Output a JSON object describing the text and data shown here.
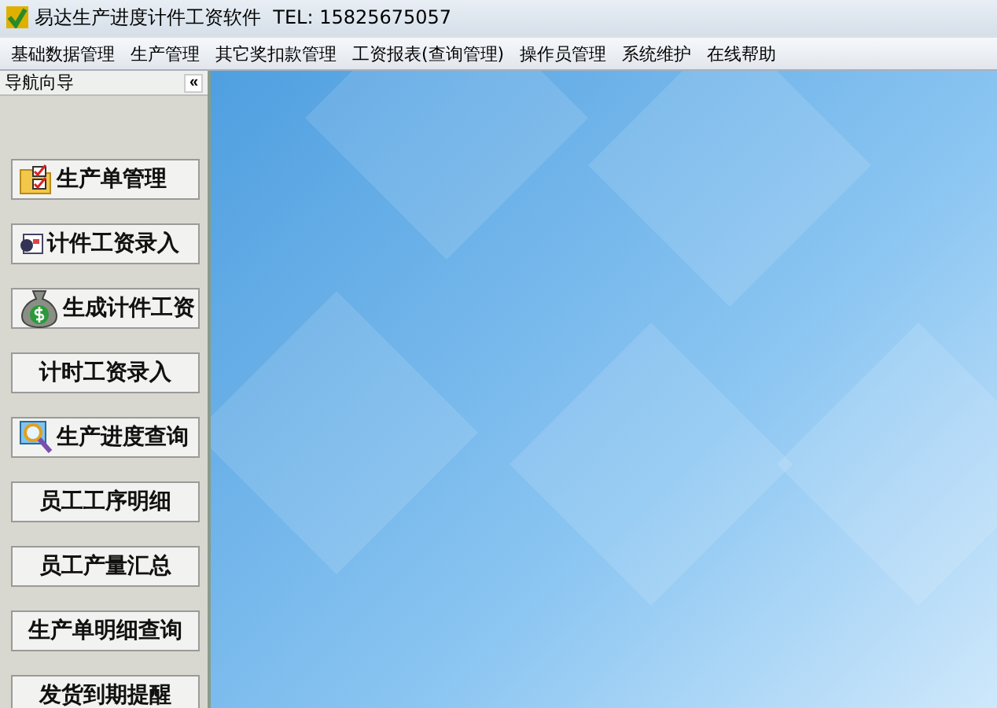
{
  "window": {
    "title": "易达生产进度计件工资软件  TEL: 15825675057"
  },
  "menu": [
    {
      "label": "基础数据管理"
    },
    {
      "label": "生产管理"
    },
    {
      "label": "其它奖扣款管理"
    },
    {
      "label": "工资报表(查询管理)"
    },
    {
      "label": "操作员管理"
    },
    {
      "label": "系统维护"
    },
    {
      "label": "在线帮助"
    }
  ],
  "sidebar": {
    "title": "导航向导",
    "collapse": "«",
    "items": [
      {
        "label": "生产单管理",
        "kind": "folder"
      },
      {
        "label": "计件工资录入",
        "kind": "card"
      },
      {
        "label": "生成计件工资",
        "kind": "moneybag"
      },
      {
        "label": "计时工资录入",
        "kind": "plain"
      },
      {
        "label": "生产进度查询",
        "kind": "magnifier"
      },
      {
        "label": "员工工序明细",
        "kind": "plain"
      },
      {
        "label": "员工产量汇总",
        "kind": "plain"
      },
      {
        "label": "生产单明细查询",
        "kind": "plain"
      },
      {
        "label": "发货到期提醒",
        "kind": "plain"
      }
    ]
  }
}
